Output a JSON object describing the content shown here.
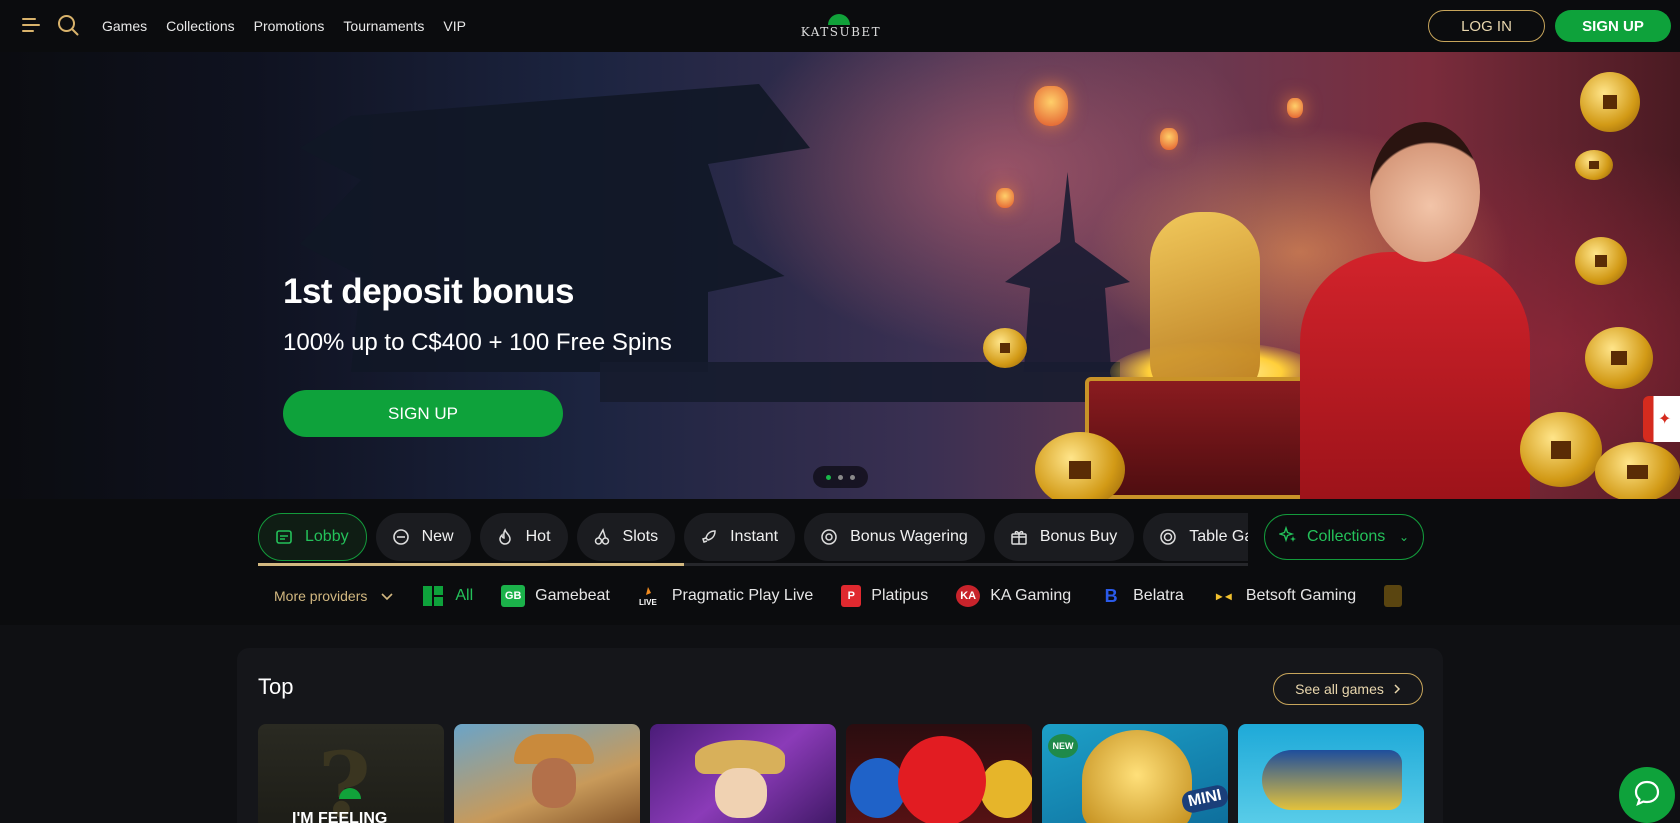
{
  "header": {
    "nav": [
      "Games",
      "Collections",
      "Promotions",
      "Tournaments",
      "VIP"
    ],
    "logo_text": "KATSUBET",
    "login_label": "LOG IN",
    "signup_label": "SIGN UP"
  },
  "hero": {
    "title": "1st deposit bonus",
    "subtitle": "100% up to C$400 + 100 Free Spins",
    "cta_label": "SIGN UP",
    "slides_count": 3,
    "active_slide": 1
  },
  "categories": {
    "tabs": [
      {
        "label": "Lobby",
        "icon": "lobby-icon",
        "active": true
      },
      {
        "label": "New",
        "icon": "new-icon"
      },
      {
        "label": "Hot",
        "icon": "fire-icon"
      },
      {
        "label": "Slots",
        "icon": "cherries-icon"
      },
      {
        "label": "Instant",
        "icon": "rocket-icon"
      },
      {
        "label": "Bonus Wagering",
        "icon": "target-icon"
      },
      {
        "label": "Bonus Buy",
        "icon": "gift-icon"
      },
      {
        "label": "Table Games",
        "icon": "chip-icon"
      }
    ],
    "scroll_progress": 0.43,
    "collections_label": "Collections"
  },
  "providers": {
    "more_label": "More providers",
    "items": [
      "All",
      "Gamebeat",
      "Pragmatic Play Live",
      "Platipus",
      "KA Gaming",
      "Belatra",
      "Betsoft Gaming"
    ]
  },
  "top": {
    "title": "Top",
    "see_all_label": "See all games",
    "feeling_lucky": "I'M FEELING",
    "new_badge": "NEW",
    "mini_badge": "MINI"
  },
  "colors": {
    "brand_green": "#0ea23b",
    "accent_gold": "#c7a55b",
    "header_bg": "#0b0c0e",
    "page_bg": "#0f1013"
  }
}
